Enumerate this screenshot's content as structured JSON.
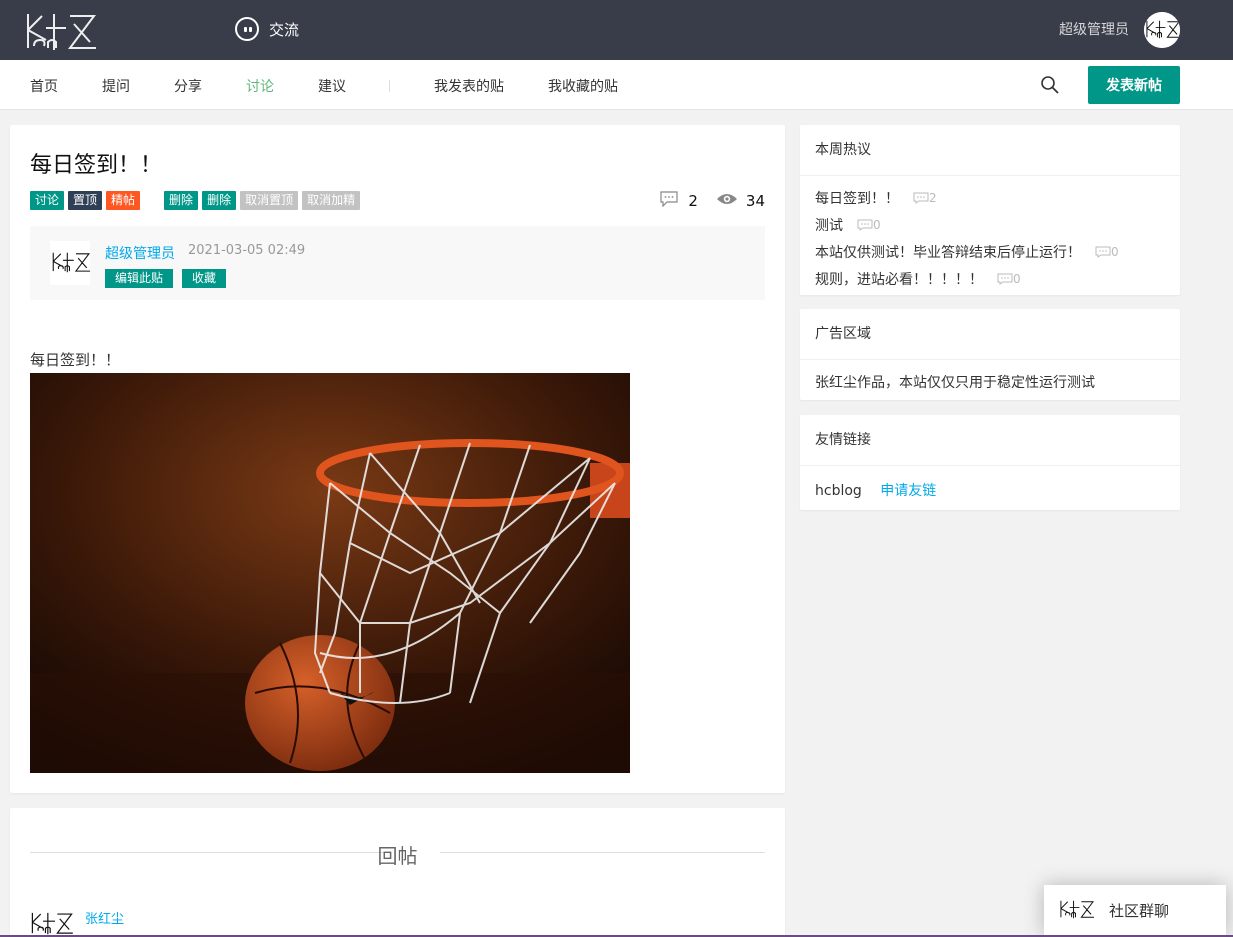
{
  "topbar": {
    "chat_label": "交流",
    "user_name": "超级管理员"
  },
  "nav": {
    "items": [
      "首页",
      "提问",
      "分享",
      "讨论",
      "建议"
    ],
    "active": "讨论",
    "my_posts": "我发表的贴",
    "my_favorites": "我收藏的贴",
    "new_post_button": "发表新帖"
  },
  "post": {
    "title": "每日签到！！",
    "tags": [
      "讨论",
      "置顶",
      "精帖"
    ],
    "admin_actions": [
      "删除",
      "删除",
      "取消置顶",
      "取消加精"
    ],
    "comment_count": "2",
    "view_count": "34",
    "author": "超级管理员",
    "time": "2021-03-05 02:49",
    "edit_button": "编辑此贴",
    "favorite_button": "收藏",
    "body": "每日签到！！"
  },
  "replies": {
    "title": "回帖",
    "first_author": "张红尘"
  },
  "sidebar": {
    "hot": {
      "title": "本周热议",
      "items": [
        {
          "title": "每日签到！！",
          "count": "2"
        },
        {
          "title": "测试",
          "count": "0"
        },
        {
          "title": "本站仅供测试！毕业答辩结束后停止运行！",
          "count": "0"
        },
        {
          "title": "规则，进站必看！！！！！",
          "count": "0"
        }
      ]
    },
    "ad": {
      "title": "广告区域",
      "text": "张红尘作品，本站仅仅只用于稳定性运行测试"
    },
    "links": {
      "title": "友情链接",
      "items": [
        "hcblog"
      ],
      "apply": "申请友链"
    }
  },
  "chat_widget": {
    "label": "社区群聊"
  },
  "colors": {
    "topbar": "#393d49",
    "accent": "#009688",
    "nav_active": "#5fb878",
    "link": "#01aaed",
    "hot_tag": "#ff5722"
  }
}
